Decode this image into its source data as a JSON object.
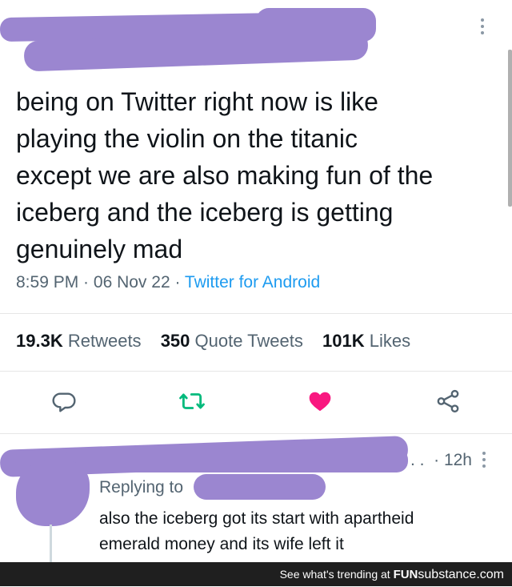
{
  "tweet": {
    "text": "being on Twitter right now is like\nplaying the violin on the titanic\nexcept we are also making fun of the\niceberg and the iceberg is getting\ngenuinely mad",
    "time": "8:59 PM",
    "date": "06 Nov 22",
    "source": "Twitter for Android",
    "sep": " · "
  },
  "stats": {
    "retweets_count": "19.3K",
    "retweets_label": "Retweets",
    "quotes_count": "350",
    "quotes_label": "Quote Tweets",
    "likes_count": "101K",
    "likes_label": "Likes"
  },
  "actions": {
    "reply_icon": "reply-bubble-icon",
    "retweet_icon": "retweet-icon",
    "like_icon": "heart-filled-icon",
    "share_icon": "share-icon"
  },
  "reply": {
    "truncated_name": ". .",
    "time_ago": "· 12h",
    "replying_to": "Replying to",
    "text": "also the iceberg got its start with apartheid\nemerald money and its wife left it"
  },
  "footer": {
    "prefix": "See what's trending at ",
    "brand_part1": "FUN",
    "brand_part2": "substance",
    "brand_part3": ".com"
  },
  "colors": {
    "text": "#0f1419",
    "secondary": "#536471",
    "link": "#1d9bf0",
    "like": "#f91880",
    "retweet": "#00ba7c",
    "redaction": "#9b86d0",
    "footer_bg": "#1f1f1f"
  }
}
